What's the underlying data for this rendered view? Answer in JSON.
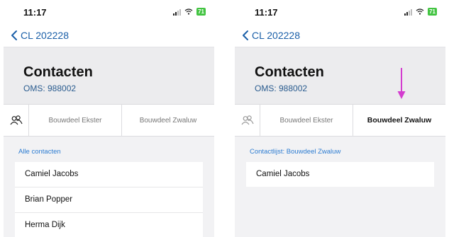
{
  "left_screen": {
    "status": {
      "time": "11:17",
      "battery": "71"
    },
    "nav": {
      "back_label": "CL 202228"
    },
    "header": {
      "title": "Contacten",
      "subtitle": "OMS: 988002"
    },
    "tabs": [
      {
        "icon": "people-icon",
        "active": true
      },
      {
        "label": "Bouwdeel Ekster",
        "active": false
      },
      {
        "label": "Bouwdeel Zwaluw",
        "active": false
      }
    ],
    "section_label": "Alle contacten",
    "contacts": [
      "Camiel Jacobs",
      "Brian Popper",
      "Herma Dijk"
    ]
  },
  "right_screen": {
    "status": {
      "time": "11:17",
      "battery": "71"
    },
    "nav": {
      "back_label": "CL 202228"
    },
    "header": {
      "title": "Contacten",
      "subtitle": "OMS: 988002"
    },
    "tabs": [
      {
        "icon": "people-icon",
        "active": false
      },
      {
        "label": "Bouwdeel Ekster",
        "active": false
      },
      {
        "label": "Bouwdeel Zwaluw",
        "active": true
      }
    ],
    "section_label": "Contactlijst: Bouwdeel Zwaluw",
    "contacts": [
      "Camiel Jacobs"
    ]
  },
  "colors": {
    "link_blue": "#1a5fa8",
    "section_blue": "#2b7bd1",
    "annotation_arrow": "#d33ccf",
    "battery_green": "#43c442"
  }
}
